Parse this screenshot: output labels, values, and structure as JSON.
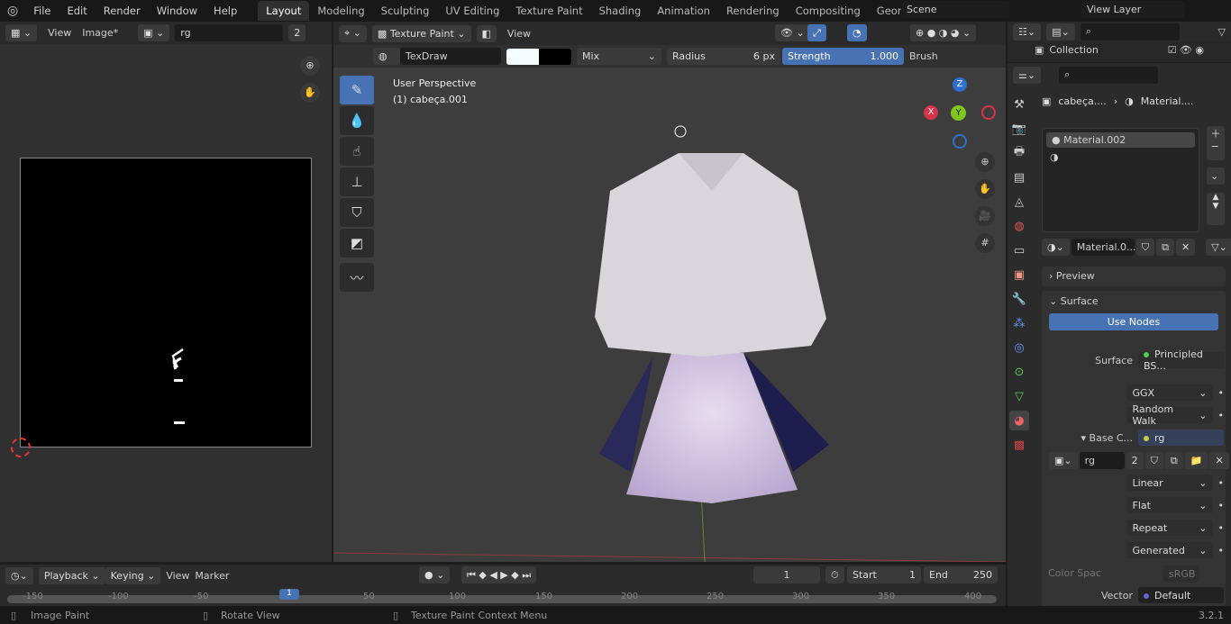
{
  "menu": [
    "File",
    "Edit",
    "Render",
    "Window",
    "Help"
  ],
  "workspaces": [
    "Layout",
    "Modeling",
    "Sculpting",
    "UV Editing",
    "Texture Paint",
    "Shading",
    "Animation",
    "Rendering",
    "Compositing",
    "Geometry Noc"
  ],
  "scene": "Scene",
  "view_layer": "View Layer",
  "image_editor": {
    "view": "View",
    "image": "Image*",
    "image_name": "rg",
    "users": "2"
  },
  "viewport": {
    "mode": "Texture Paint",
    "view": "View",
    "brush": "TexDraw",
    "blend": "Mix",
    "radius_label": "Radius",
    "radius": "6 px",
    "strength_label": "Strength",
    "strength": "1.000",
    "brush_menu": "Brush",
    "perspective": "User Perspective",
    "object": "(1) cabeça.001",
    "colors": {
      "primary": "#f4fbff",
      "secondary": "#000000"
    }
  },
  "gizmo": {
    "x": "X",
    "y": "Y",
    "z": "Z"
  },
  "outliner": {
    "collection": "Collection"
  },
  "properties": {
    "breadcrumb_obj": "cabeça....",
    "breadcrumb_mat": "Material....",
    "slot": "Material.002",
    "material": "Material.0...",
    "preview": "Preview",
    "surface": "Surface",
    "use_nodes": "Use Nodes",
    "surface_label": "Surface",
    "surface_val": "Principled BS...",
    "dist": "GGX",
    "sss": "Random Walk",
    "base_label": "Base C...",
    "base_val": "rg",
    "img_name": "rg",
    "img_users": "2",
    "interp": "Linear",
    "proj": "Flat",
    "ext": "Repeat",
    "source": "Generated",
    "colorspace_label": "Color Spac",
    "colorspace": "sRGB",
    "vector_label": "Vector",
    "vector": "Default"
  },
  "timeline": {
    "playback": "Playback",
    "keying": "Keying",
    "view": "View",
    "marker": "Marker",
    "frame": "1",
    "start_label": "Start",
    "start": "1",
    "end_label": "End",
    "end": "250",
    "current": "1",
    "ticks": [
      "-150",
      "-100",
      "-50",
      "1",
      "50",
      "100",
      "150",
      "200",
      "250",
      "300",
      "350",
      "400"
    ]
  },
  "status": {
    "left": "Image Paint",
    "middle": "Rotate View",
    "right": "Texture Paint Context Menu",
    "version": "3.2.1"
  }
}
